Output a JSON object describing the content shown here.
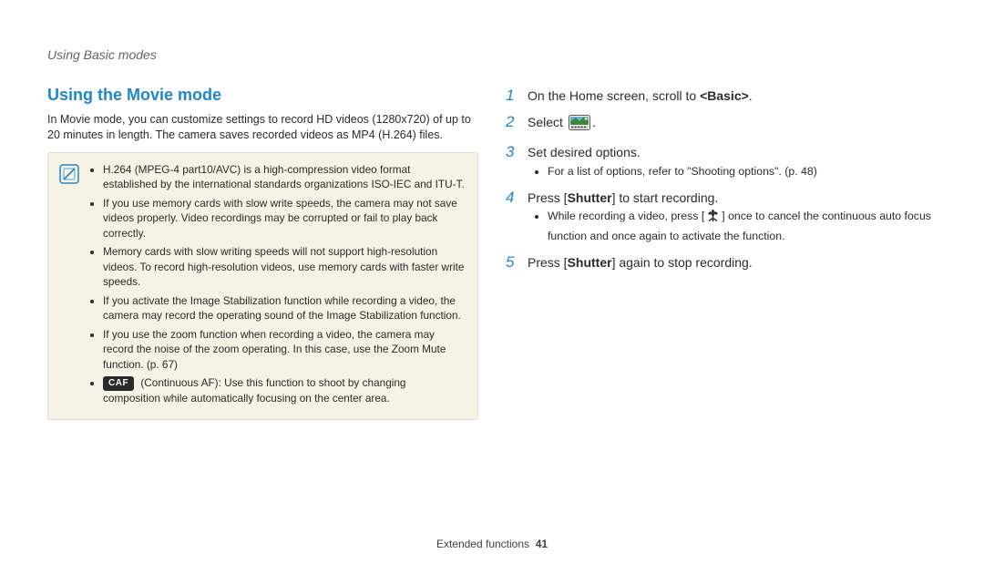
{
  "breadcrumb": "Using Basic modes",
  "section_title": "Using the Movie mode",
  "intro": "In Movie mode, you can customize settings to record HD videos (1280x720) of up to 20 minutes in length. The camera saves recorded videos as MP4 (H.264) files.",
  "note_icon": "note-slash-icon",
  "note": {
    "bullets": [
      "H.264 (MPEG-4 part10/AVC) is a high-compression video format established by the international standards organizations ISO-IEC and ITU-T.",
      "If you use memory cards with slow write speeds, the camera may not save videos properly. Video recordings may be corrupted or fail to play back correctly.",
      "Memory cards with slow writing speeds will not support high-resolution videos. To record high-resolution videos, use memory cards with faster write speeds.",
      "If you activate the Image Stabilization function while recording a video, the camera may record the operating sound of the Image Stabilization function.",
      "If you use the zoom function when recording a video, the camera may record the noise of the zoom operating. In this case, use the Zoom Mute function. (p. 67)"
    ],
    "caf_label": "CAF",
    "caf_text": " (Continuous AF): Use this function to shoot by changing composition while automatically focusing on the center area."
  },
  "steps": [
    {
      "n": "1",
      "text_pre": "On the Home screen, scroll to ",
      "bold": "<Basic>",
      "text_post": "."
    },
    {
      "n": "2",
      "text_pre": "Select ",
      "icon": "movie-mode-icon",
      "text_post": "."
    },
    {
      "n": "3",
      "text_pre": "Set desired options.",
      "sub": [
        "For a list of options, refer to \"Shooting options\". (p. 48)"
      ]
    },
    {
      "n": "4",
      "text_pre": "Press [",
      "bold": "Shutter",
      "text_post": "] to start recording.",
      "sub_pre": "While recording a video, press [",
      "sub_icon": "flower-macro-icon",
      "sub_post": "] once to cancel the continuous auto focus function and once again to activate the function."
    },
    {
      "n": "5",
      "text_pre": "Press [",
      "bold": "Shutter",
      "text_post": "] again to stop recording."
    }
  ],
  "footer_label": "Extended functions",
  "footer_page": "41"
}
